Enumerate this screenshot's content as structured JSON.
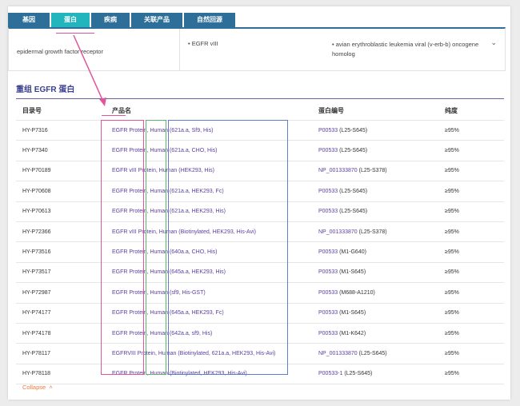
{
  "tabs": [
    {
      "label": "基因"
    },
    {
      "label": "蛋白"
    },
    {
      "label": "疾病"
    },
    {
      "label": "关联产品"
    },
    {
      "label": "自然回源"
    }
  ],
  "info": {
    "col1": "epidermal growth factor receptor",
    "col2": "• EGFR vIII",
    "col3": "• avian erythroblastic leukemia viral (v-erb-b) oncogene homolog"
  },
  "section_title": "重组 EGFR 蛋白",
  "table": {
    "headers": [
      "目录号",
      "产品名",
      "蛋白编号",
      "纯度"
    ],
    "rows": [
      {
        "catalog": "HY-P7316",
        "name": "EGFR Protein, Human (621a.a, Sf9, His)",
        "protein": "P00533",
        "range": "(L25-S645)",
        "purity": "≥95%"
      },
      {
        "catalog": "HY-P7340",
        "name": "EGFR Protein, Human (621a.a, CHO, His)",
        "protein": "P00533",
        "range": "(L25-S645)",
        "purity": "≥95%"
      },
      {
        "catalog": "HY-P70189",
        "name": "EGFR vIII Protein, Human (HEK293, His)",
        "protein": "NP_001333870",
        "range": "(L25-S378)",
        "purity": "≥95%"
      },
      {
        "catalog": "HY-P70608",
        "name": "EGFR Protein, Human (621a.a, HEK293, Fc)",
        "protein": "P00533",
        "range": "(L25-S645)",
        "purity": "≥95%"
      },
      {
        "catalog": "HY-P70613",
        "name": "EGFR Protein, Human (621a.a, HEK293, His)",
        "protein": "P00533",
        "range": "(L25-S645)",
        "purity": "≥95%"
      },
      {
        "catalog": "HY-P72366",
        "name": "EGFR vIII Protein, Human (Biotinylated, HEK293, His-Avi)",
        "protein": "NP_001333870",
        "range": "(L25-S378)",
        "purity": "≥95%"
      },
      {
        "catalog": "HY-P73516",
        "name": "EGFR Protein, Human (640a.a, CHO, His)",
        "protein": "P00533",
        "range": "(M1-G640)",
        "purity": "≥95%"
      },
      {
        "catalog": "HY-P73517",
        "name": "EGFR Protein, Human (645a.a, HEK293, His)",
        "protein": "P00533",
        "range": "(M1-S645)",
        "purity": "≥95%"
      },
      {
        "catalog": "HY-P72987",
        "name": "EGFR Protein, Human (sf9, His-GST)",
        "protein": "P00533",
        "range": "(M688-A1210)",
        "purity": "≥95%"
      },
      {
        "catalog": "HY-P74177",
        "name": "EGFR Protein, Human (645a.a, HEK293, Fc)",
        "protein": "P00533",
        "range": "(M1-S645)",
        "purity": "≥95%"
      },
      {
        "catalog": "HY-P74178",
        "name": "EGFR Protein, Human (642a.a, sf9, His)",
        "protein": "P00533",
        "range": "(M1-K642)",
        "purity": "≥95%"
      },
      {
        "catalog": "HY-P78117",
        "name": "EGFRVIII Protein, Human (Biotinylated, 621a.a, HEK293, His-Avi)",
        "protein": "NP_001333870",
        "range": "(L25-S645)",
        "purity": "≥95%"
      },
      {
        "catalog": "HY-P78118",
        "name": "EGFR Protein, Human (Biotinylated, HEK293, His-Avi)",
        "protein": "P00533-1",
        "range": "(L25-S645)",
        "purity": "≥95%"
      }
    ]
  },
  "collapse_label": "Collapse",
  "colors": {
    "tab": "#2e6f9a",
    "tab_active": "#22b5be",
    "link": "#5a3fa0",
    "annotation_pink": "#e0569a",
    "annotation_green": "#5fb36a",
    "annotation_blue": "#5b7fc8",
    "collapse": "#f07a3a"
  }
}
